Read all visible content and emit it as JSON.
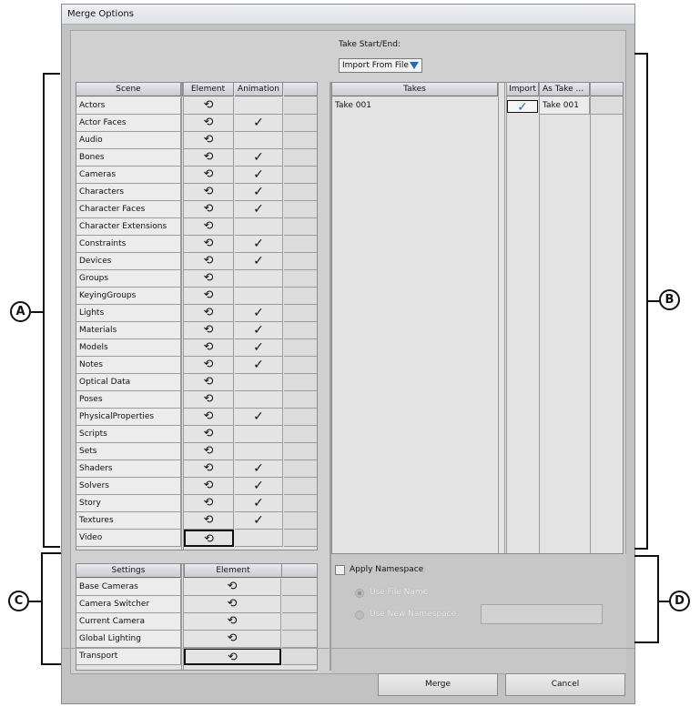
{
  "window": {
    "title": "Merge Options"
  },
  "take": {
    "label": "Take Start/End:",
    "dropdown_value": "Import From File"
  },
  "scene_table": {
    "headers": [
      "Scene",
      "Element",
      "Animation"
    ],
    "rows": [
      {
        "name": "Actors",
        "animation": false
      },
      {
        "name": "Actor Faces",
        "animation": true
      },
      {
        "name": "Audio",
        "animation": false
      },
      {
        "name": "Bones",
        "animation": true
      },
      {
        "name": "Cameras",
        "animation": true
      },
      {
        "name": "Characters",
        "animation": true
      },
      {
        "name": "Character Faces",
        "animation": true
      },
      {
        "name": "Character Extensions",
        "animation": false
      },
      {
        "name": "Constraints",
        "animation": true
      },
      {
        "name": "Devices",
        "animation": true
      },
      {
        "name": "Groups",
        "animation": false
      },
      {
        "name": "KeyingGroups",
        "animation": false
      },
      {
        "name": "Lights",
        "animation": true
      },
      {
        "name": "Materials",
        "animation": true
      },
      {
        "name": "Models",
        "animation": true
      },
      {
        "name": "Notes",
        "animation": true
      },
      {
        "name": "Optical Data",
        "animation": false
      },
      {
        "name": "Poses",
        "animation": false
      },
      {
        "name": "PhysicalProperties",
        "animation": true
      },
      {
        "name": "Scripts",
        "animation": false
      },
      {
        "name": "Sets",
        "animation": false
      },
      {
        "name": "Shaders",
        "animation": true
      },
      {
        "name": "Solvers",
        "animation": true
      },
      {
        "name": "Story",
        "animation": true
      },
      {
        "name": "Textures",
        "animation": true
      },
      {
        "name": "Video",
        "animation": false
      }
    ]
  },
  "takes_table": {
    "headers": [
      "Takes",
      "Import",
      "As Take ..."
    ],
    "rows": [
      {
        "take": "Take 001",
        "import": true,
        "as_take": "Take 001"
      }
    ]
  },
  "settings_table": {
    "headers": [
      "Settings",
      "Element"
    ],
    "rows": [
      "Base Cameras",
      "Camera Switcher",
      "Current Camera",
      "Global Lighting",
      "Transport"
    ]
  },
  "namespace": {
    "apply_label": "Apply Namespace",
    "use_file_name": "Use File Name",
    "use_new_namespace": "Use New Namespace"
  },
  "buttons": {
    "merge": "Merge",
    "cancel": "Cancel"
  },
  "callouts": {
    "a": "A",
    "b": "B",
    "c": "C",
    "d": "D"
  },
  "icons": {
    "element": "refresh-icon",
    "animation": "checkmark-icon",
    "dropdown": "triangle-down-icon"
  }
}
